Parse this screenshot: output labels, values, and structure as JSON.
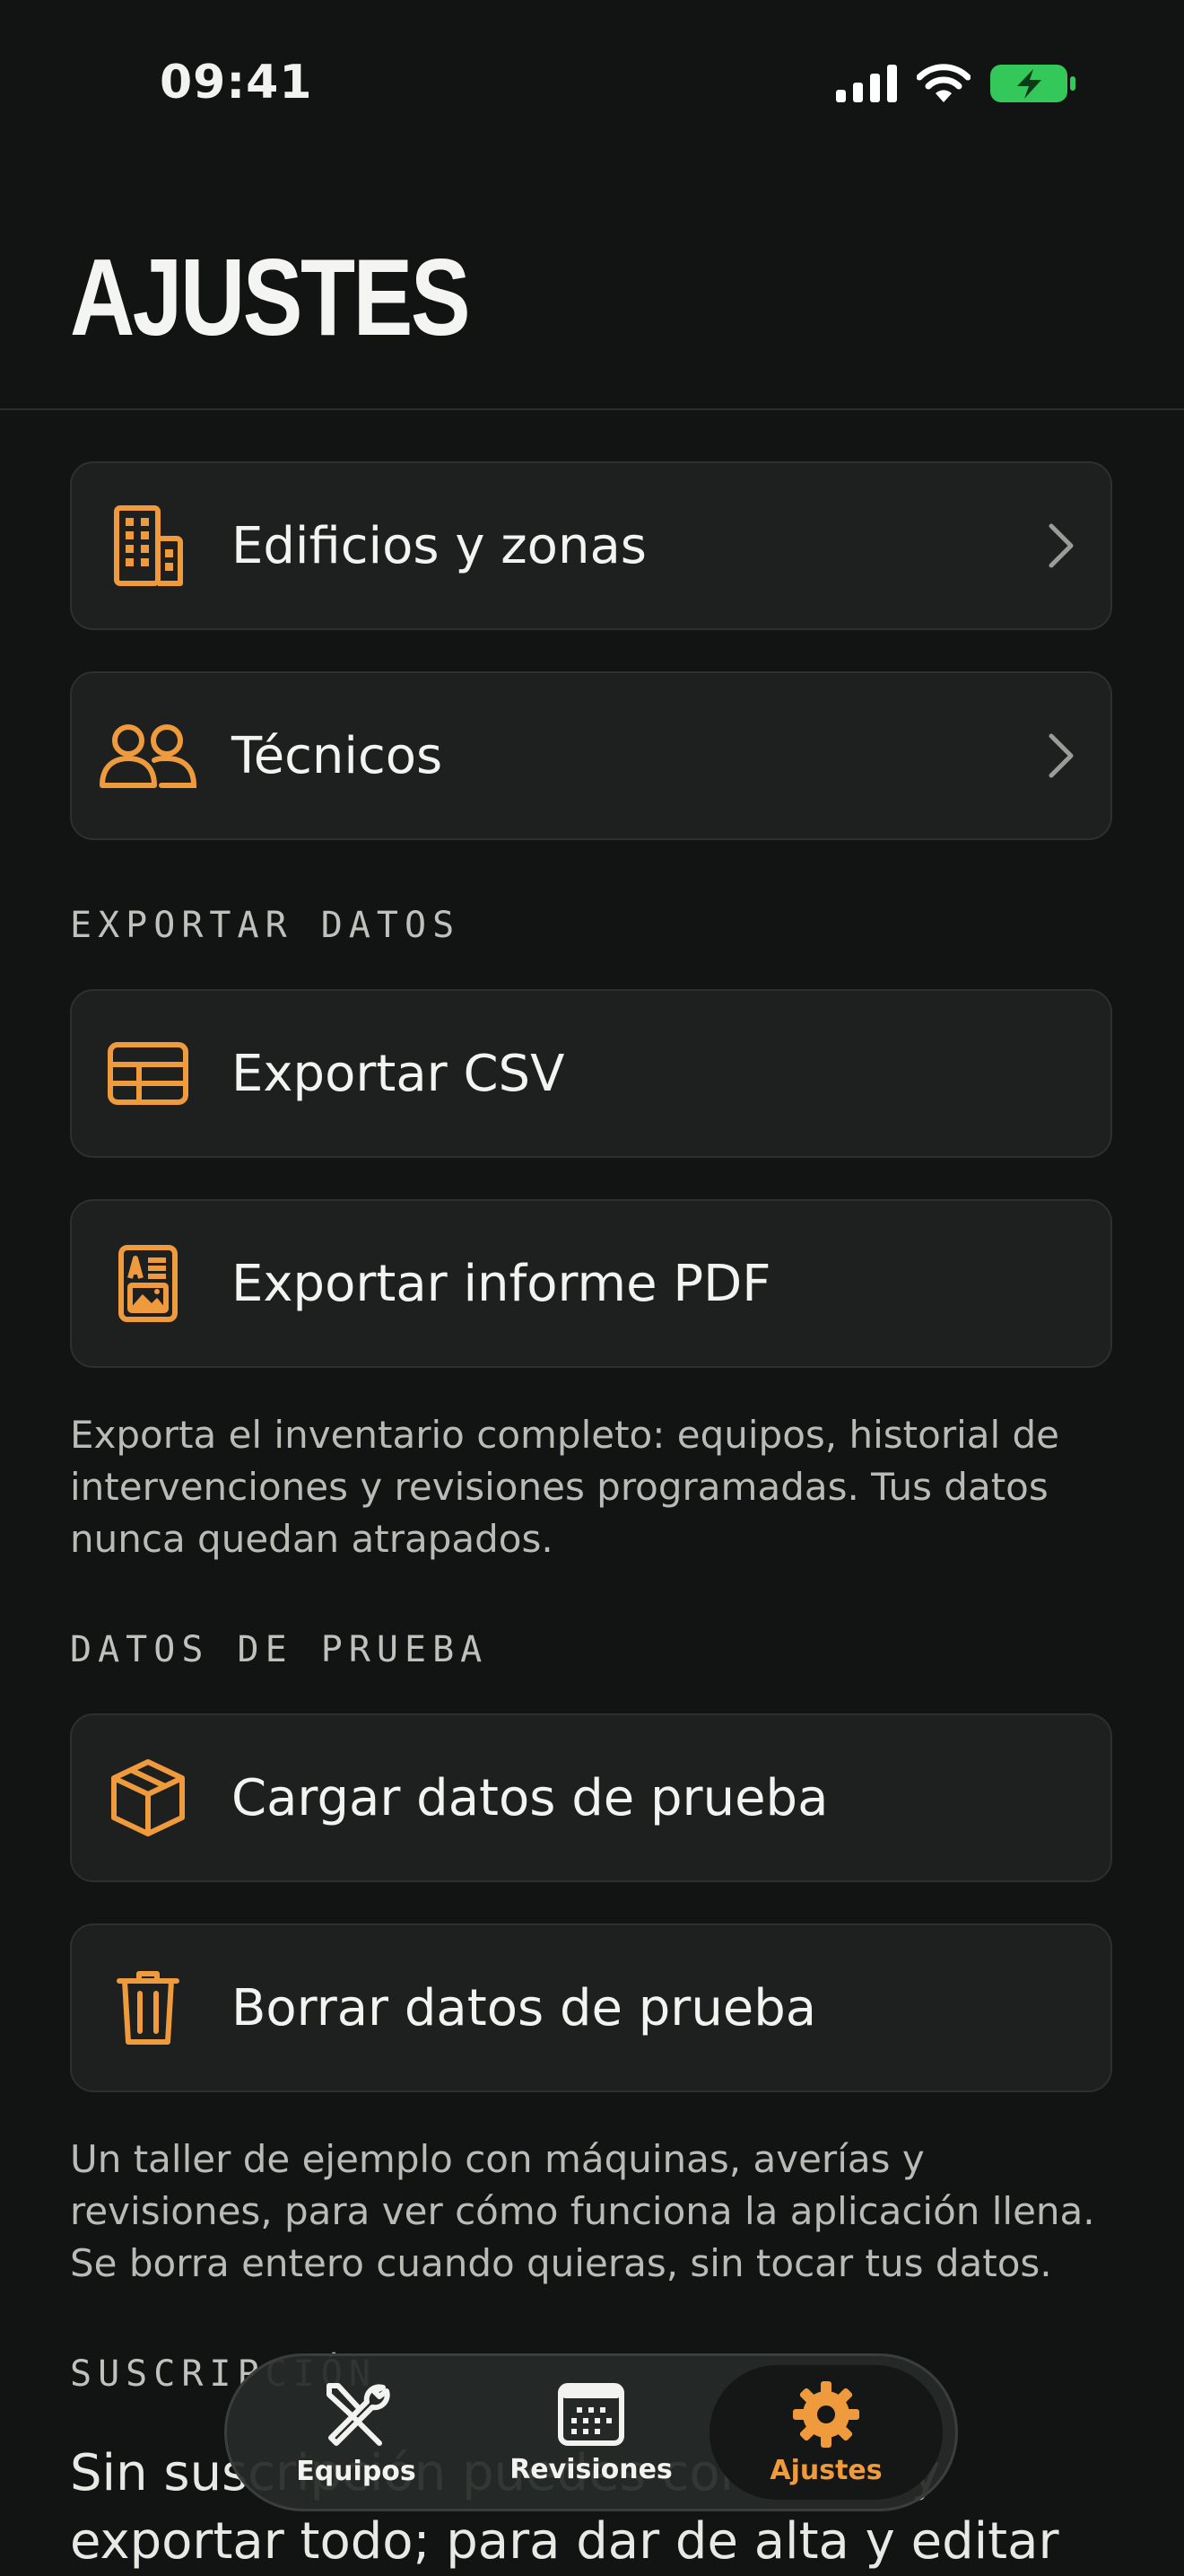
{
  "status_bar": {
    "time": "09:41"
  },
  "header": {
    "title": "AJUSTES"
  },
  "settings": {
    "rows": [
      {
        "label": "Edificios y zonas",
        "icon": "building-icon"
      },
      {
        "label": "Técnicos",
        "icon": "users-icon"
      }
    ]
  },
  "export": {
    "header": "EXPORTAR DATOS",
    "rows": [
      {
        "label": "Exportar CSV",
        "icon": "table-icon"
      },
      {
        "label": "Exportar informe PDF",
        "icon": "report-icon"
      }
    ],
    "note": "Exporta el inventario completo: equipos, historial de intervenciones y revisiones programadas. Tus datos nunca quedan atrapados."
  },
  "test_data": {
    "header": "DATOS DE PRUEBA",
    "rows": [
      {
        "label": "Cargar datos de prueba",
        "icon": "box-icon"
      },
      {
        "label": "Borrar datos de prueba",
        "icon": "trash-icon"
      }
    ],
    "note": "Un taller de ejemplo con máquinas, averías y revisiones, para ver cómo funciona la aplicación llena. Se borra entero cuando quieras, sin tocar tus datos."
  },
  "subscription": {
    "header": "SUSCRIPCIÓN",
    "text": "Sin suscripción puedes consultar y exportar todo; para dar de alta y editar"
  },
  "tab_bar": {
    "tabs": [
      {
        "label": "Equipos",
        "icon": "tools-icon"
      },
      {
        "label": "Revisiones",
        "icon": "calendar-icon"
      },
      {
        "label": "Ajustes",
        "icon": "gear-icon"
      }
    ],
    "selected": "Ajustes"
  },
  "colors": {
    "accent": "#ef9a3d",
    "background": "#111413",
    "card": "#1d201f",
    "battery": "#34c759"
  }
}
